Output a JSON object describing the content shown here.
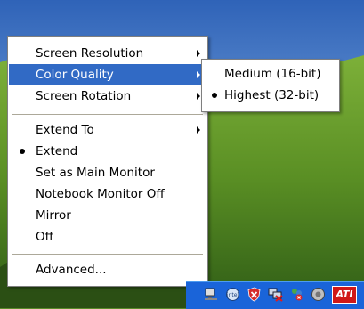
{
  "colors": {
    "menu_highlight": "#316ac5",
    "tray_blue": "#1a64d9"
  },
  "main_menu": {
    "items": [
      {
        "label": "Screen Resolution",
        "has_submenu": true
      },
      {
        "label": "Color Quality",
        "has_submenu": true,
        "highlighted": true
      },
      {
        "label": "Screen Rotation",
        "has_submenu": true
      },
      {
        "label": "Extend To",
        "has_submenu": true
      },
      {
        "label": "Extend",
        "checked": true
      },
      {
        "label": "Set as Main Monitor"
      },
      {
        "label": "Notebook Monitor Off"
      },
      {
        "label": "Mirror"
      },
      {
        "label": "Off"
      },
      {
        "label": "Advanced..."
      }
    ]
  },
  "sub_menu": {
    "items": [
      {
        "label": "Medium (16-bit)"
      },
      {
        "label": "Highest (32-bit)",
        "checked": true
      }
    ]
  },
  "tray": {
    "icons": [
      "network-icon",
      "display-settings-icon",
      "security-shield-icon",
      "network-disconnected-icon",
      "wireless-error-icon",
      "volume-icon",
      "ati-icon"
    ],
    "ati_label": "ATI"
  }
}
